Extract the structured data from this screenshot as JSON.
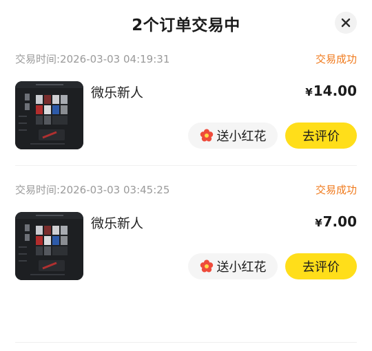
{
  "header": {
    "title": "2个订单交易中"
  },
  "orders": [
    {
      "time": "交易时间:2026-03-03 04:19:31",
      "status": "交易成功",
      "product_name": "微乐新人",
      "currency": "¥",
      "price": "14.00",
      "flower_label": "送小红花",
      "review_label": "去评价"
    },
    {
      "time": "交易时间:2026-03-03 03:45:25",
      "status": "交易成功",
      "product_name": "微乐新人",
      "currency": "¥",
      "price": "7.00",
      "flower_label": "送小红花",
      "review_label": "去评价"
    }
  ],
  "icons": {
    "close": "close-icon",
    "flower": "red-flower-icon"
  },
  "colors": {
    "accent": "#ffde1a",
    "status": "#f07a1c",
    "flower": "#ee4b3b",
    "thumb_bg": "#1d1f22"
  }
}
